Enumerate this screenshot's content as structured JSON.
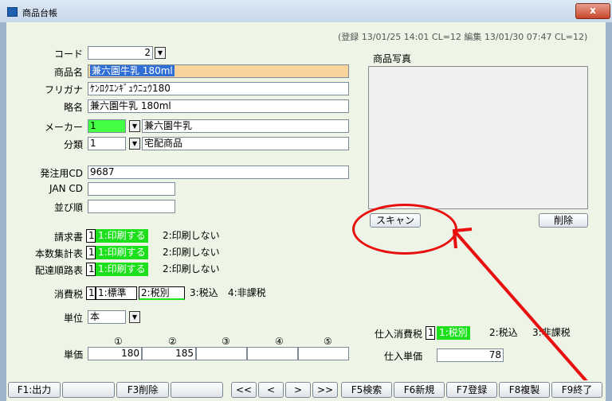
{
  "window": {
    "title": "商品台帳",
    "close_label": "x"
  },
  "status": "(登録 13/01/25 14:01 CL=12  編集 13/01/30 07:47 CL=12)",
  "form": {
    "code": {
      "label": "コード",
      "value": "2"
    },
    "product_name": {
      "label": "商品名",
      "value": "兼六園牛乳 180ml"
    },
    "furigana": {
      "label": "フリガナ",
      "value": "ｹﾝﾛｸｴﾝｷﾞｭｳﾆｭｳ180"
    },
    "short_name": {
      "label": "略名",
      "value": "兼六園牛乳 180ml"
    },
    "maker": {
      "label": "メーカー",
      "code": "1",
      "name": "兼六園牛乳"
    },
    "category": {
      "label": "分類",
      "code": "1",
      "name": "宅配商品"
    },
    "order_cd": {
      "label": "発注用CD",
      "value": "9687"
    },
    "jan_cd": {
      "label": "JAN CD",
      "value": ""
    },
    "sort_order": {
      "label": "並び順",
      "value": ""
    }
  },
  "print_options": [
    {
      "label": "請求書",
      "code": "1",
      "selected": "1:印刷する",
      "other": "2:印刷しない"
    },
    {
      "label": "本数集計表",
      "code": "1",
      "selected": "1:印刷する",
      "other": "2:印刷しない"
    },
    {
      "label": "配達順路表",
      "code": "1",
      "selected": "1:印刷する",
      "other": "2:印刷しない"
    }
  ],
  "tax": {
    "label": "消費税",
    "code": "1",
    "opt1": "1:標準",
    "opt2": "2:税別",
    "opt3": "3:税込",
    "opt4": "4:非課税"
  },
  "unit": {
    "label": "単位",
    "value": "本"
  },
  "prices": {
    "label": "単価",
    "headers": [
      "①",
      "②",
      "③",
      "④",
      "⑤"
    ],
    "values": [
      "180",
      "185",
      "",
      "",
      ""
    ]
  },
  "purchase_tax": {
    "label": "仕入消費税",
    "code": "1",
    "selected": "1:税別",
    "opt2": "2:税込",
    "opt3": "3:非課税"
  },
  "purchase_price": {
    "label": "仕入単価",
    "value": "78"
  },
  "photo": {
    "label": "商品写真",
    "scan": "スキャン",
    "delete": "削除"
  },
  "fkeys": {
    "f1": "F1:出力",
    "f3": "F3削除",
    "first": "<<",
    "prev": "<",
    "next": ">",
    "last": ">>",
    "f5": "F5検索",
    "f6": "F6新規",
    "f7": "F7登録",
    "f8": "F8複製",
    "f9": "F9終了"
  },
  "colors": {
    "annotation": "#e8100f",
    "selected_option": "#1de01d",
    "highlight_field": "#f9d39c"
  }
}
